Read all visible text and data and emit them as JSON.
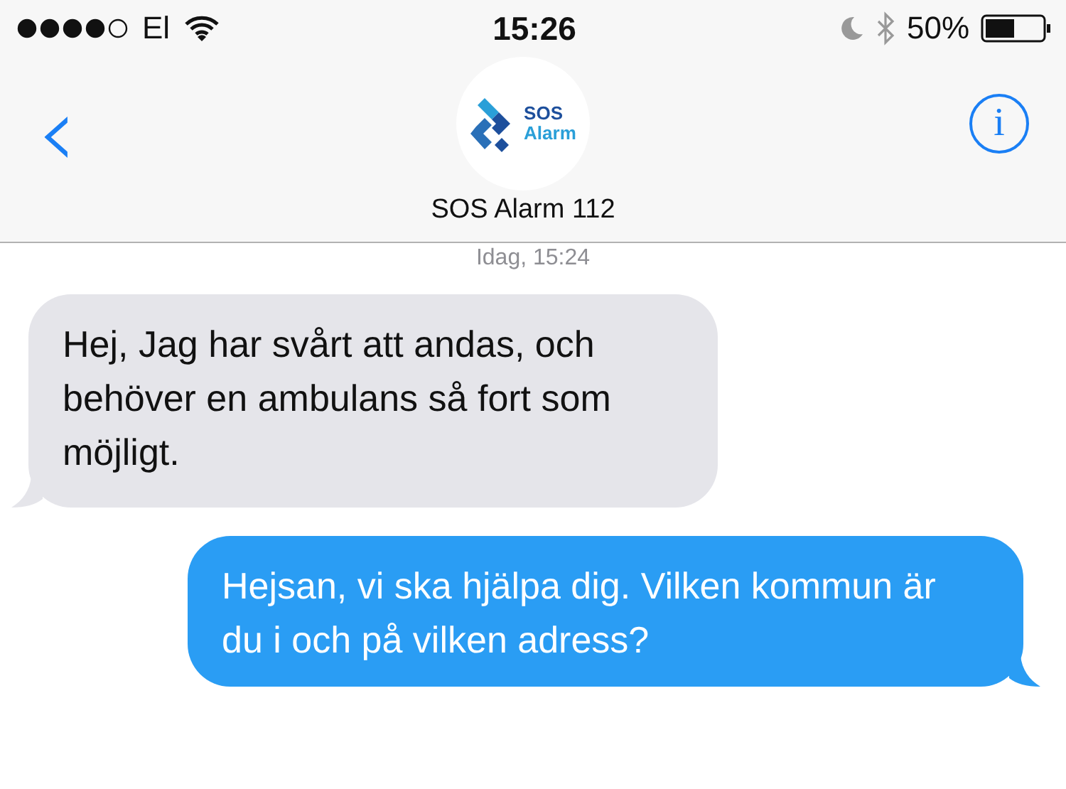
{
  "status_bar": {
    "carrier": "El",
    "time": "15:26",
    "battery": "50%"
  },
  "header": {
    "back": "‹",
    "logo_lines": [
      "SOS",
      "Alarm"
    ],
    "contact": "SOS Alarm 112",
    "info": "i"
  },
  "timestamp": "Idag, 15:24",
  "messages": [
    {
      "kind": "incoming",
      "text": "Hej, Jag har svårt att andas, och behöver en ambulans så fort som möjligt."
    },
    {
      "kind": "outgoing",
      "text": "Hejsan, vi ska hjälpa dig. Vilken kommun är du i och på vilken adress?"
    }
  ]
}
